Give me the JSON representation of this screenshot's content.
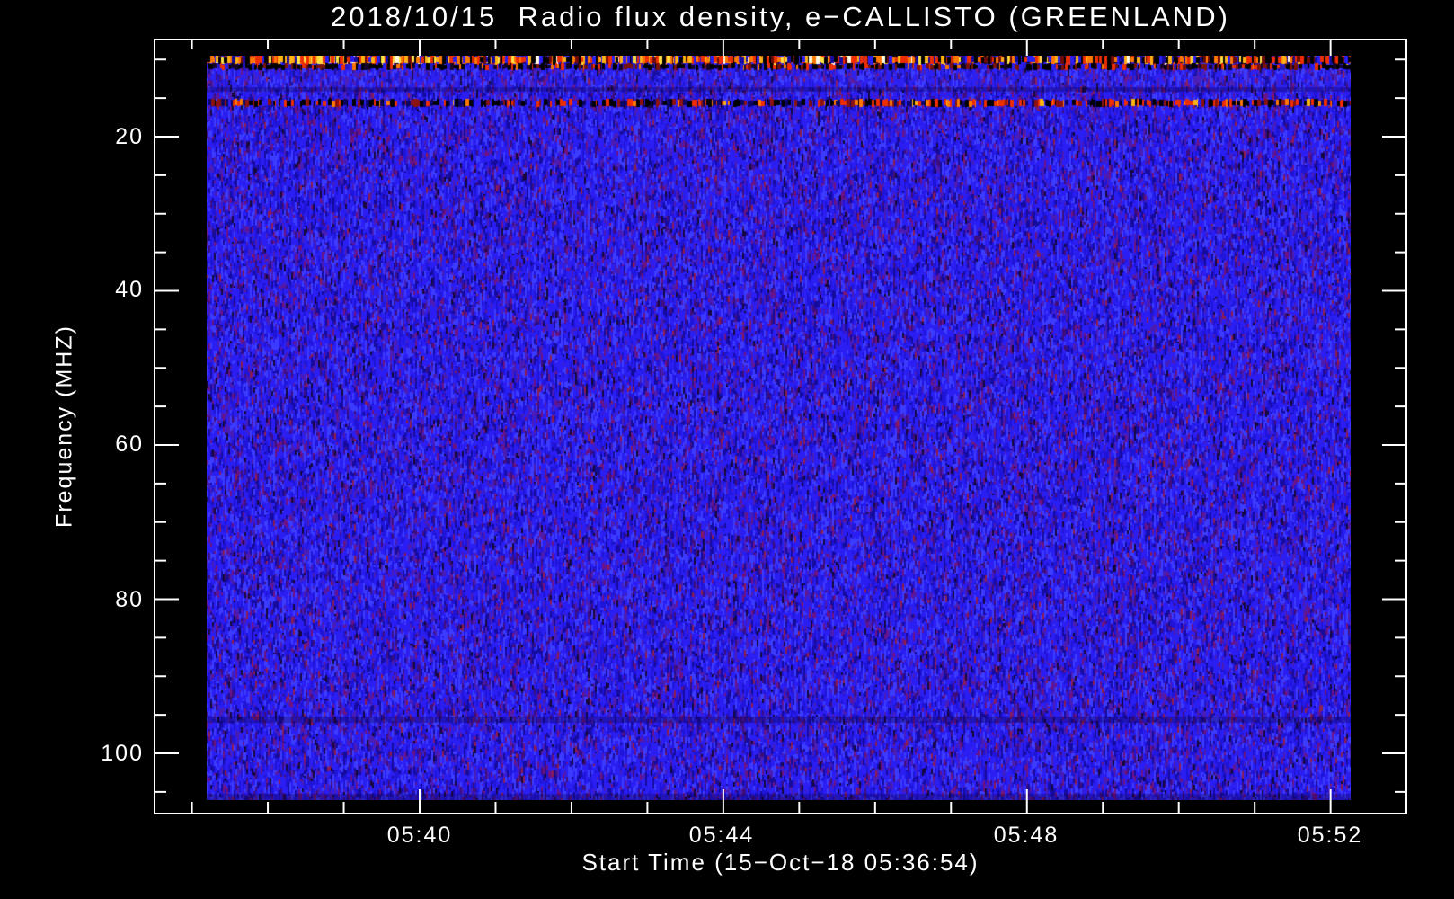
{
  "chart_data": {
    "type": "heatmap",
    "title": "2018/10/15  Radio flux density, e−CALLISTO (GREENLAND)",
    "xlabel": "Start Time (15−Oct−18 05:36:54)",
    "ylabel": "Frequency (MHZ)",
    "x_tick_labels": [
      "05:40",
      "05:44",
      "05:48",
      "05:52"
    ],
    "x_major_tick_minutes": [
      40,
      44,
      48,
      52
    ],
    "x_minor_tick_minutes": [
      37,
      38,
      39,
      41,
      42,
      43,
      45,
      46,
      47,
      49,
      50,
      51,
      53
    ],
    "y_major_ticks": [
      20,
      40,
      60,
      80,
      100
    ],
    "y_minor_ticks": [
      10,
      15,
      25,
      30,
      35,
      45,
      50,
      55,
      65,
      70,
      75,
      85,
      90,
      95,
      105
    ],
    "y_unit": "MHZ",
    "time_range": [
      "05:37:11",
      "05:52:16"
    ],
    "freq_range_mhz": [
      9.5,
      106.1
    ],
    "grid": false,
    "legend": null,
    "colors": {
      "background": "#000000",
      "axis": "#ffffff",
      "text": "#ffffff",
      "noise_base": [
        "#2a1ef2",
        "#3c3cff",
        "#1f14d8",
        "#150b9e",
        "#4a1cb4",
        "#3f0e7e",
        "#6e1282",
        "#16083c",
        "#8e1d50"
      ],
      "rfi_bright": [
        "#ee2d00",
        "#ff7800",
        "#ffb414",
        "#ffe146",
        "#fff8e1"
      ],
      "rfi_dark": "#000000"
    },
    "rfi_bands": [
      {
        "name": "band-10mhz-bright-rfi",
        "freq_mhz": [
          9.5,
          10.55
        ],
        "style": "bright_speckle"
      },
      {
        "name": "band-11mhz-dark-rfi",
        "freq_mhz": [
          10.55,
          11.35
        ],
        "style": "dark_speckle"
      },
      {
        "name": "band-16mhz-dark-rfi",
        "freq_mhz": [
          15.25,
          16.2
        ],
        "style": "dark_red_speckle"
      },
      {
        "name": "band-14mhz-faint-notch",
        "freq_mhz": [
          13.6,
          14.2
        ],
        "style": "faint_dark"
      },
      {
        "name": "band-95mhz-faint-notch",
        "freq_mhz": [
          95.2,
          96.0
        ],
        "style": "faint_dark"
      },
      {
        "name": "band-bottom-edge",
        "freq_mhz": [
          105.3,
          106.1
        ],
        "style": "faint_dark"
      }
    ]
  }
}
